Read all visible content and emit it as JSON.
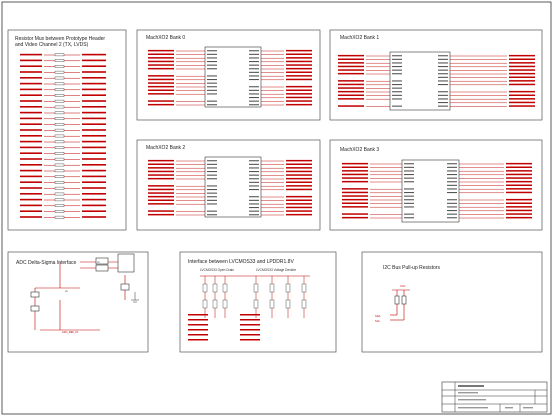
{
  "panels": {
    "resistor_mux": {
      "title_line1": "Resistor Mux between Prototype Header",
      "title_line2": "and Video Channel 2 (TX, LVDS)"
    },
    "bank0": {
      "title": "MachXO2 Bank 0"
    },
    "bank1": {
      "title": "MachXO2 Bank 1"
    },
    "bank2": {
      "title": "MachXO2 Bank 2"
    },
    "bank3": {
      "title": "MachXO2 Bank 3"
    },
    "adc": {
      "title": "ADC Delta-Sigma Interface"
    },
    "interface": {
      "title": "Interface between LVCMOS33 and LPDDR1.8V",
      "sub_left": "LVCMOS33 Open Drain",
      "sub_right": "LVCMOS33 Voltage Devider"
    },
    "i2c": {
      "title": "I2C Bus Pull-up Resistors"
    }
  },
  "colors": {
    "net": "#c00000",
    "outline": "#555555",
    "text": "#222222"
  }
}
